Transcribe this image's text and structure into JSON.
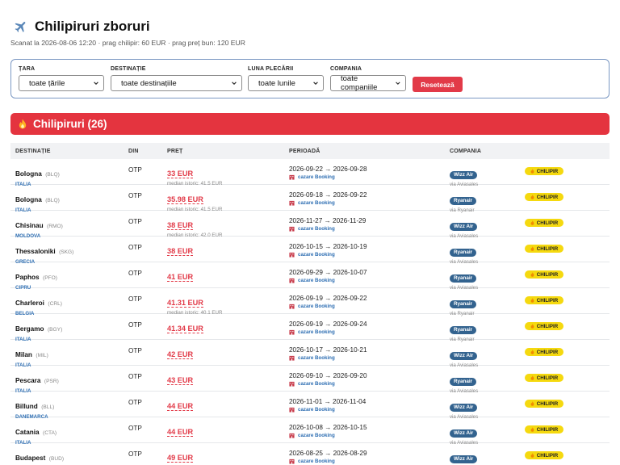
{
  "header": {
    "title": "Chilipiruri zboruri",
    "subtitle": "Scanat la 2026-08-06 12:20 · prag chilipir: 60 EUR · prag preț bun: 120 EUR"
  },
  "filters": {
    "country_label": "ȚARA",
    "country_value": "toate țările",
    "destination_label": "DESTINAȚIE",
    "destination_value": "toate destinațiile",
    "month_label": "LUNA PLECĂRII",
    "month_value": "toate lunile",
    "company_label": "COMPANIA",
    "company_value": "toate companiile",
    "reset_label": "Resetează"
  },
  "banner": {
    "label": "Chilipiruri (26)"
  },
  "table": {
    "columns": [
      "DESTINAȚIE",
      "DIN",
      "PREȚ",
      "PERIOADĂ",
      "COMPANIA"
    ],
    "hotel_label": "cazare Booking",
    "badge_label": "CHILIPIR",
    "rows": [
      {
        "city": "Bologna",
        "code": "(BLQ)",
        "country": "ITALIA",
        "from": "OTP",
        "price": "33 EUR",
        "median": "median istoric: 41.5 EUR",
        "dates": "2026-09-22 → 2026-09-28",
        "airline": "Wizz Air",
        "via": "via Aviasales"
      },
      {
        "city": "Bologna",
        "code": "(BLQ)",
        "country": "ITALIA",
        "from": "OTP",
        "price": "35.98 EUR",
        "median": "median istoric: 41.5 EUR",
        "dates": "2026-09-18 → 2026-09-22",
        "airline": "Ryanair",
        "via": "via Ryanair"
      },
      {
        "city": "Chisinau",
        "code": "(RMO)",
        "country": "MOLDOVA",
        "from": "OTP",
        "price": "38 EUR",
        "median": "median istoric: 42.0 EUR",
        "dates": "2026-11-27 → 2026-11-29",
        "airline": "Wizz Air",
        "via": "via Aviasales"
      },
      {
        "city": "Thessaloniki",
        "code": "(SKG)",
        "country": "GRECIA",
        "from": "OTP",
        "price": "38 EUR",
        "median": "",
        "dates": "2026-10-15 → 2026-10-19",
        "airline": "Ryanair",
        "via": "via Aviasales"
      },
      {
        "city": "Paphos",
        "code": "(PFO)",
        "country": "CIPRU",
        "from": "OTP",
        "price": "41 EUR",
        "median": "",
        "dates": "2026-09-29 → 2026-10-07",
        "airline": "Ryanair",
        "via": "via Aviasales"
      },
      {
        "city": "Charleroi",
        "code": "(CRL)",
        "country": "BELGIA",
        "from": "OTP",
        "price": "41.31 EUR",
        "median": "median istoric: 40.1 EUR",
        "dates": "2026-09-19 → 2026-09-22",
        "airline": "Ryanair",
        "via": "via Ryanair"
      },
      {
        "city": "Bergamo",
        "code": "(BGY)",
        "country": "ITALIA",
        "from": "OTP",
        "price": "41.34 EUR",
        "median": "",
        "dates": "2026-09-19 → 2026-09-24",
        "airline": "Ryanair",
        "via": "via Ryanair"
      },
      {
        "city": "Milan",
        "code": "(MIL)",
        "country": "ITALIA",
        "from": "OTP",
        "price": "42 EUR",
        "median": "",
        "dates": "2026-10-17 → 2026-10-21",
        "airline": "Wizz Air",
        "via": "via Aviasales"
      },
      {
        "city": "Pescara",
        "code": "(PSR)",
        "country": "ITALIA",
        "from": "OTP",
        "price": "43 EUR",
        "median": "",
        "dates": "2026-09-10 → 2026-09-20",
        "airline": "Ryanair",
        "via": "via Aviasales"
      },
      {
        "city": "Billund",
        "code": "(BLL)",
        "country": "DANEMARCA",
        "from": "OTP",
        "price": "44 EUR",
        "median": "",
        "dates": "2026-11-01 → 2026-11-04",
        "airline": "Wizz Air",
        "via": "via Aviasales"
      },
      {
        "city": "Catania",
        "code": "(CTA)",
        "country": "ITALIA",
        "from": "OTP",
        "price": "44 EUR",
        "median": "",
        "dates": "2026-10-08 → 2026-10-15",
        "airline": "Wizz Air",
        "via": "via Aviasales"
      },
      {
        "city": "Budapest",
        "code": "(BUD)",
        "country": "UNGARIA",
        "from": "OTP",
        "price": "49 EUR",
        "median": "",
        "dates": "2026-08-25 → 2026-08-29",
        "airline": "Wizz Air",
        "via": "via Aviasales"
      }
    ]
  },
  "colors": {
    "accent_red": "#e4343f",
    "link_blue": "#2f6fb3",
    "airline_badge": "#33638f",
    "chilipir_yellow": "#f5d90f"
  },
  "icons": [
    "plane-icon",
    "fire-icon",
    "chevron-down-icon",
    "hotel-icon"
  ]
}
